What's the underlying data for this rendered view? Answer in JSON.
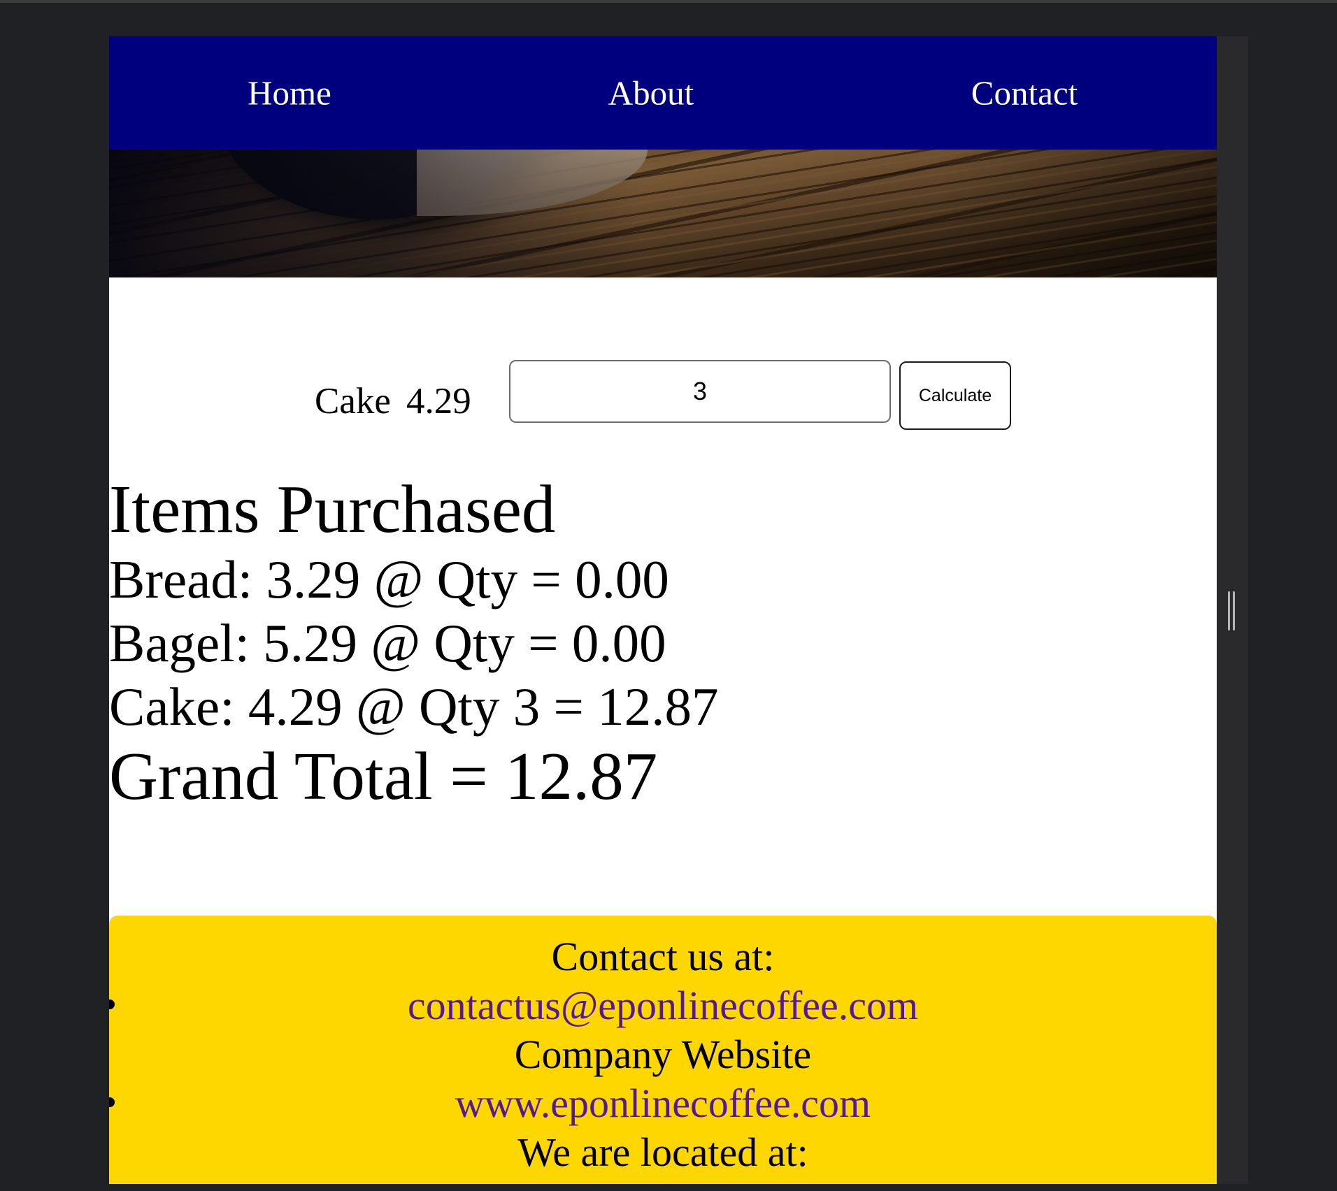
{
  "nav": {
    "home": "Home",
    "about": "About",
    "contact": "Contact"
  },
  "order_form": {
    "item_name": "Cake",
    "item_price": "4.29",
    "quantity_value": "3",
    "calculate_label": "Calculate"
  },
  "summary": {
    "heading": "Items Purchased",
    "lines": [
      "Bread: 3.29 @ Qty = 0.00",
      "Bagel: 5.29 @ Qty = 0.00",
      "Cake: 4.29 @ Qty 3 = 12.87"
    ],
    "grand_total": "Grand Total = 12.87"
  },
  "footer": {
    "contact_heading": "Contact us at:",
    "email": "contactus@eponlinecoffee.com",
    "website_heading": "Company Website",
    "website": "www.eponlinecoffee.com",
    "location_heading": "We are located at:"
  },
  "colors": {
    "nav_background": "#00007f",
    "footer_background": "#ffd700",
    "link_color": "#551a8b",
    "window_background": "#202124"
  },
  "icons": {
    "footer_bullets": "bullet-icon",
    "window_resize": "resize-handle-icon"
  }
}
